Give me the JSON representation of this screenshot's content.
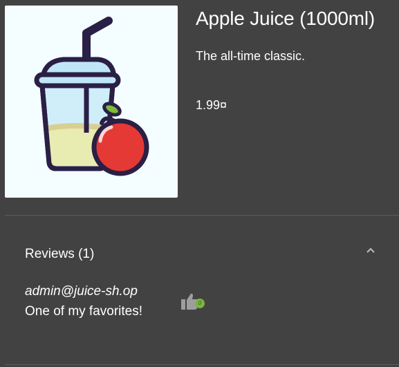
{
  "product": {
    "name": "Apple Juice (1000ml)",
    "description": "The all-time classic.",
    "price": "1.99¤"
  },
  "reviews": {
    "header_label": "Reviews (1)",
    "items": [
      {
        "author": "admin@juice-sh.op",
        "message": "One of my favorites!",
        "likes": "0"
      }
    ]
  },
  "icons": {
    "chevron": "chevron-up-icon",
    "like": "thumbs-up-icon"
  },
  "colors": {
    "background": "#424242",
    "image_background": "#f4fdff",
    "like_badge": "#7cb342"
  }
}
